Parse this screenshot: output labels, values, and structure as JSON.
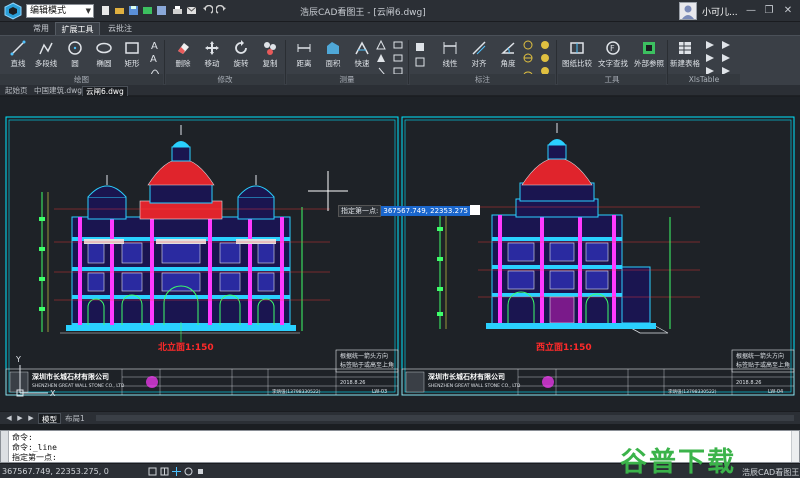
{
  "titlebar": {
    "mode": "编辑模式",
    "title": "浩辰CAD看图王 - [云闸6.dwg]",
    "username": "小可儿...",
    "minimize": "—",
    "restore": "❐",
    "close": "✕"
  },
  "ribbon_tabs": [
    "常用",
    "扩展工具",
    "云批注"
  ],
  "ribbon": {
    "tools": [
      {
        "name": "line",
        "label": "直线"
      },
      {
        "name": "polyline",
        "label": "多段线"
      },
      {
        "name": "circle",
        "label": "圆"
      },
      {
        "name": "ellipse",
        "label": "椭圆"
      },
      {
        "name": "rectangle",
        "label": "矩形"
      },
      {
        "name": "delete",
        "label": "删除"
      },
      {
        "name": "move",
        "label": "移动"
      },
      {
        "name": "rotate",
        "label": "旋转"
      },
      {
        "name": "copy",
        "label": "复制"
      },
      {
        "name": "distance",
        "label": "距离"
      },
      {
        "name": "area",
        "label": "面积"
      },
      {
        "name": "quick",
        "label": "快速"
      },
      {
        "name": "linear",
        "label": "线性"
      },
      {
        "name": "aligned",
        "label": "对齐"
      },
      {
        "name": "angle",
        "label": "角度"
      },
      {
        "name": "drawing-compare",
        "label": "图纸比较"
      },
      {
        "name": "text-search",
        "label": "文字查找"
      },
      {
        "name": "xref",
        "label": "外部参照"
      },
      {
        "name": "new-table",
        "label": "新建表格"
      }
    ],
    "groups": [
      "绘图",
      "修改",
      "测量",
      "标注",
      "工具",
      "XlsTable"
    ]
  },
  "doc_tabs": [
    "起始页",
    "中国建筑.dwg",
    "云闸6.dwg"
  ],
  "drawing": {
    "left_title": "北立面1:150",
    "right_title": "西立面1:150",
    "note_line1": "根据统一箭头方向",
    "note_line2": "标签贴于或高至上角",
    "left_company_cn": "深圳市长城石材有限公司",
    "left_company_en": "SHENZHEN GREAT WALL STONE CO., LTD",
    "right_company_cn": "深圳市长城石材有限公司",
    "right_company_en": "SHENZHEN GREAT WALL STONE CO., LTD",
    "left_date": "2018.8.26",
    "right_date": "2018.8.26",
    "left_code": "LW-03",
    "right_code": "LW-04",
    "left_phone": "李炳强(13798330522)",
    "right_phone": "李炳强(13798330522)",
    "tooltip_prompt": "指定第一点:",
    "tooltip_coords": "367567.749, 22353.275",
    "ucs_y": "Y",
    "ucs_x": "X"
  },
  "layout_tabs": [
    "模型",
    "布局1"
  ],
  "command_window": {
    "lines": [
      "命令:",
      "命令:_line",
      "指定第一点:"
    ]
  },
  "statusbar": {
    "coords": "367567.749, 22353.275, 0",
    "app_name": "浩辰CAD看图王"
  },
  "watermark": {
    "text": "谷普下载"
  },
  "colors": {
    "accent": "#1a66cc",
    "drawing_frame": "#00e5ff",
    "dome": "#e0242c",
    "facade": "#2ad0ff",
    "title_red": "#ff2a2a"
  }
}
